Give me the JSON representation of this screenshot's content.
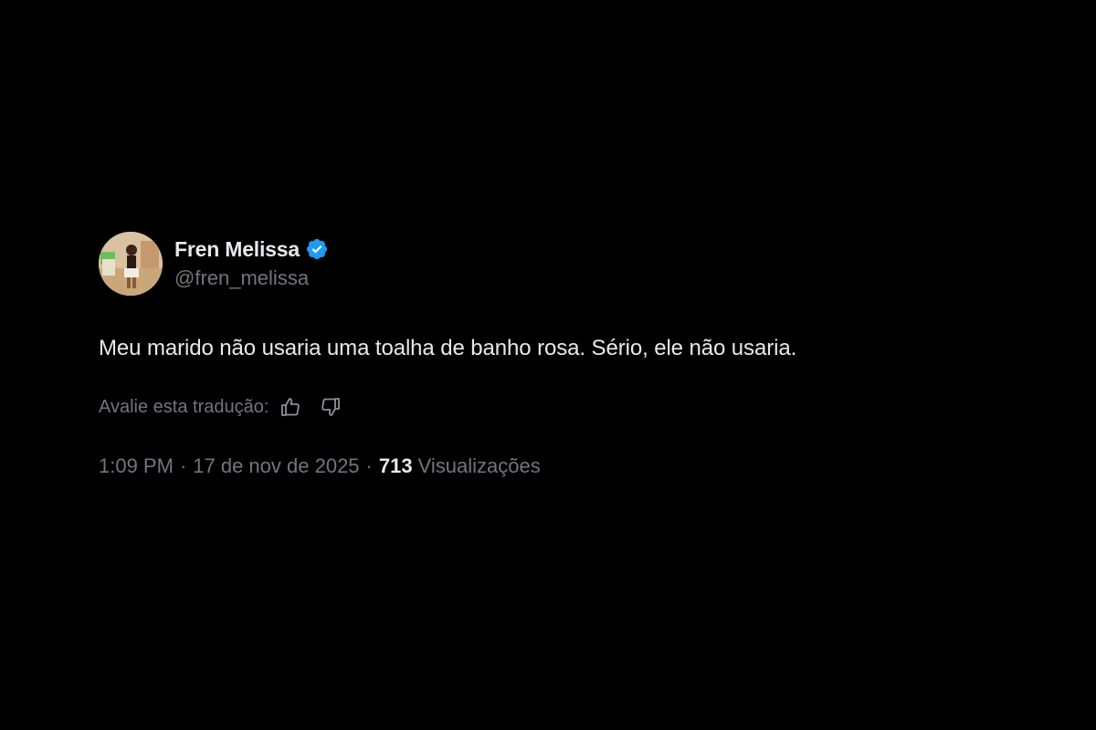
{
  "tweet": {
    "display_name": "Fren Melissa",
    "handle": "@fren_melissa",
    "verified_badge_color": "#1d9bf0",
    "verified_icon": "verified-badge-icon",
    "text": "Meu marido não usaria uma toalha de banho rosa. Sério, ele não usaria.",
    "translation_rating": {
      "label": "Avalie esta tradução:",
      "thumbs_up_icon": "thumbs-up-icon",
      "thumbs_down_icon": "thumbs-down-icon"
    },
    "meta": {
      "time": "1:09 PM",
      "separator": "·",
      "date": "17 de nov de 2025",
      "views_count": "713",
      "views_label": "Visualizações"
    }
  },
  "colors": {
    "background": "#000000",
    "primary_text": "#e7e9ea",
    "secondary_text": "#71767b"
  }
}
